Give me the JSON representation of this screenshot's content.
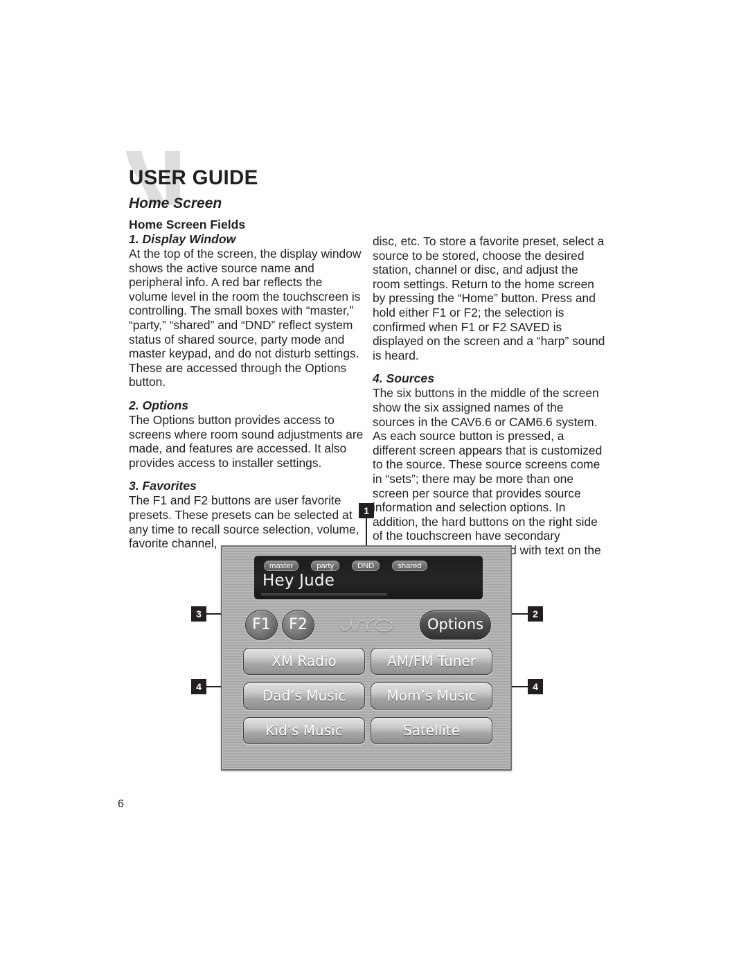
{
  "document": {
    "header_title": "USER GUIDE",
    "header_subtitle": "Home Screen",
    "page_number": "6",
    "logo_watermark": "n-logo-watermark"
  },
  "left_column": {
    "section_heading": "Home Screen Fields",
    "item1_heading": "1. Display Window",
    "item1_body": "At the top of the screen, the display window shows the active source name and peripheral info. A red bar reflects the volume level in the room the touchscreen is controlling. The small boxes with “master,” “party,” “shared” and “DND” reflect system status of shared source, party mode and master keypad, and do not disturb settings. These are accessed through the Options button.",
    "item2_heading": "2. Options",
    "item2_body": "The Options button provides access to screens where room sound adjustments are made, and features are accessed. It also provides access to installer settings.",
    "item3_heading": "3. Favorites",
    "item3_body": "The F1 and F2 buttons are user favorite presets. These presets can be selected at any time to recall source selection, volume, favorite channel,"
  },
  "right_column": {
    "continuation_body": "disc, etc. To store a favorite preset, select a source to be stored, choose the desired station, channel or disc, and adjust the room settings. Return to the home screen by pressing the “Home” button. Press and hold either F1 or F2; the selection is confirmed when F1 or F2 SAVED is displayed on the screen and a “harp” sound is heard.",
    "item4_heading": "4. Sources",
    "item4_body": "The six buttons in the middle of the screen show the six assigned names of the sources in the CAV6.6 or CAM6.6 system. As each source button is pressed, a different screen appears that is customized to the source. These source screens come in “sets”; there may be more than one screen per source that provides source information and selection options. In addition, the hard buttons on the right side of the touchscreen have secondary functions that are indicated with text on the specific source screens."
  },
  "device": {
    "brand_logo": "uno-script-logo",
    "display": {
      "now_playing": "Hey Jude",
      "badges": [
        "master",
        "party",
        "DND",
        "shared"
      ],
      "volume_bar_label": "volume-level-bar"
    },
    "favorites": [
      "F1",
      "F2"
    ],
    "options_label": "Options",
    "sources": [
      "XM Radio",
      "AM/FM Tuner",
      "Dad’s Music",
      "Mom’s Music",
      "Kid’s Music",
      "Satellite"
    ]
  },
  "callouts": {
    "c1": "1",
    "c2": "2",
    "c3": "3",
    "c4_left": "4",
    "c4_right": "4"
  },
  "colors": {
    "ink": "#231f20",
    "watermark": "#dcdddf",
    "bezel": "#b0b1b3",
    "display_bg": "#1d1c1c"
  }
}
